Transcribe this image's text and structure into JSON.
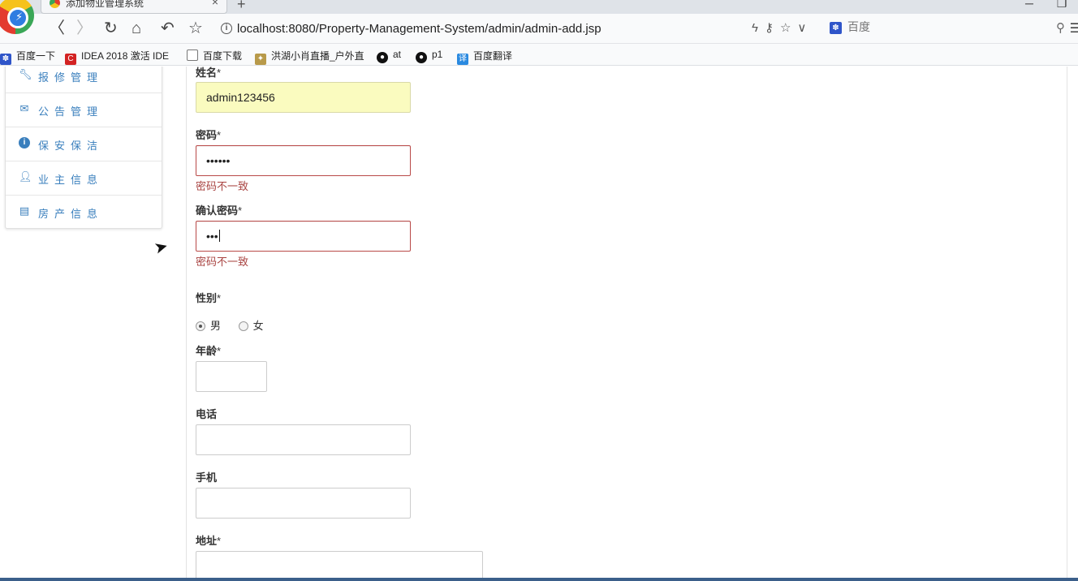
{
  "browser": {
    "tab_title": "添加物业管理系统",
    "new_tab": "+",
    "tab_close": "×",
    "url": "localhost:8080/Property-Management-System/admin/admin-add.jsp",
    "search_placeholder": "百度",
    "bookmarks": [
      {
        "label": "百度一下",
        "icon": "paw-icon"
      },
      {
        "label": "IDEA 2018 激活 IDE",
        "icon": "c-icon"
      },
      {
        "label": "百度下载",
        "icon": "page-icon"
      },
      {
        "label": "洪湖小肖直播_户外直",
        "icon": "bird-icon"
      },
      {
        "label": "at",
        "icon": "github-icon"
      },
      {
        "label": "p1",
        "icon": "github-icon"
      },
      {
        "label": "百度翻译",
        "icon": "translate-icon"
      }
    ]
  },
  "sidebar": {
    "items": [
      {
        "label": "报修管理",
        "icon": "wrench-icon"
      },
      {
        "label": "公告管理",
        "icon": "envelope-icon"
      },
      {
        "label": "保安保洁",
        "icon": "info-icon"
      },
      {
        "label": "业主信息",
        "icon": "user-icon"
      },
      {
        "label": "房产信息",
        "icon": "list-icon"
      }
    ]
  },
  "form": {
    "name_label": "姓名",
    "name_value": "admin123456",
    "password_label": "密码",
    "password_value": "••••••",
    "password_error": "密码不一致",
    "confirm_label": "确认密码",
    "confirm_value": "•••",
    "confirm_error": "密码不一致",
    "gender_label": "性别",
    "gender_options": [
      "男",
      "女"
    ],
    "gender_selected": "男",
    "age_label": "年龄",
    "phone_label": "电话",
    "mobile_label": "手机",
    "address_label": "地址",
    "required_mark": "*"
  }
}
